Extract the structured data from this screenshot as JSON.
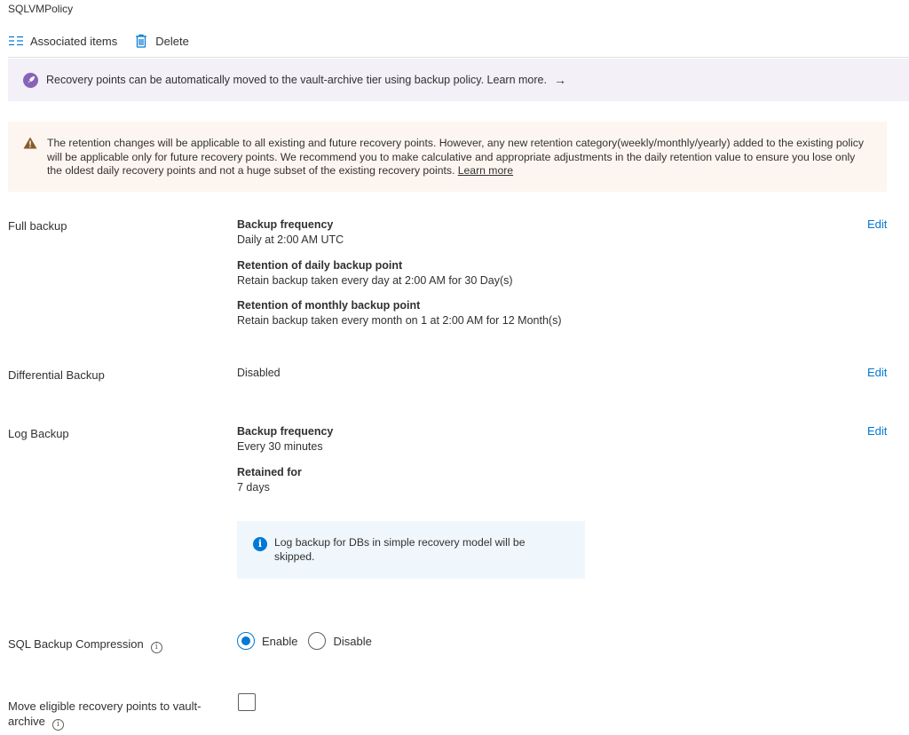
{
  "title": "SQLVMPolicy",
  "toolbar": {
    "associated_items": "Associated items",
    "delete": "Delete"
  },
  "archive_banner": {
    "text": "Recovery points can be automatically moved to the vault-archive tier using backup policy. Learn more.",
    "arrow": "→"
  },
  "warning_banner": {
    "text": "The retention changes will be applicable to all existing and future recovery points. However, any new retention category(weekly/monthly/yearly) added to the existing policy will be applicable only for future recovery points. We recommend you to make calculative and appropriate adjustments in the daily retention value to ensure you lose only the oldest daily recovery points and not a huge subset of the existing recovery points.",
    "link": "Learn more"
  },
  "full_backup": {
    "label": "Full backup",
    "edit": "Edit",
    "freq_heading": "Backup frequency",
    "freq_value": "Daily at 2:00 AM UTC",
    "daily_heading": "Retention of daily backup point",
    "daily_value": "Retain backup taken every day at 2:00 AM for 30 Day(s)",
    "monthly_heading": "Retention of monthly backup point",
    "monthly_value": "Retain backup taken every month on 1 at 2:00 AM for 12 Month(s)"
  },
  "differential_backup": {
    "label": "Differential Backup",
    "value": "Disabled",
    "edit": "Edit"
  },
  "log_backup": {
    "label": "Log Backup",
    "edit": "Edit",
    "freq_heading": "Backup frequency",
    "freq_value": "Every 30 minutes",
    "retained_heading": "Retained for",
    "retained_value": "7 days",
    "info_text": "Log backup for DBs in simple recovery model will be skipped."
  },
  "compression": {
    "label": "SQL Backup Compression",
    "enable": "Enable",
    "disable": "Disable",
    "selected": "Enable"
  },
  "archive": {
    "label": "Move eligible recovery points to vault-archive",
    "checked": false
  },
  "colors": {
    "accent": "#0078d4",
    "purple_banner": "#f3f0f8",
    "warning_banner": "#fdf6f0",
    "info_box": "#eff6fc",
    "warning_icon": "#8a5a2b",
    "rocket": "#8764b8"
  }
}
